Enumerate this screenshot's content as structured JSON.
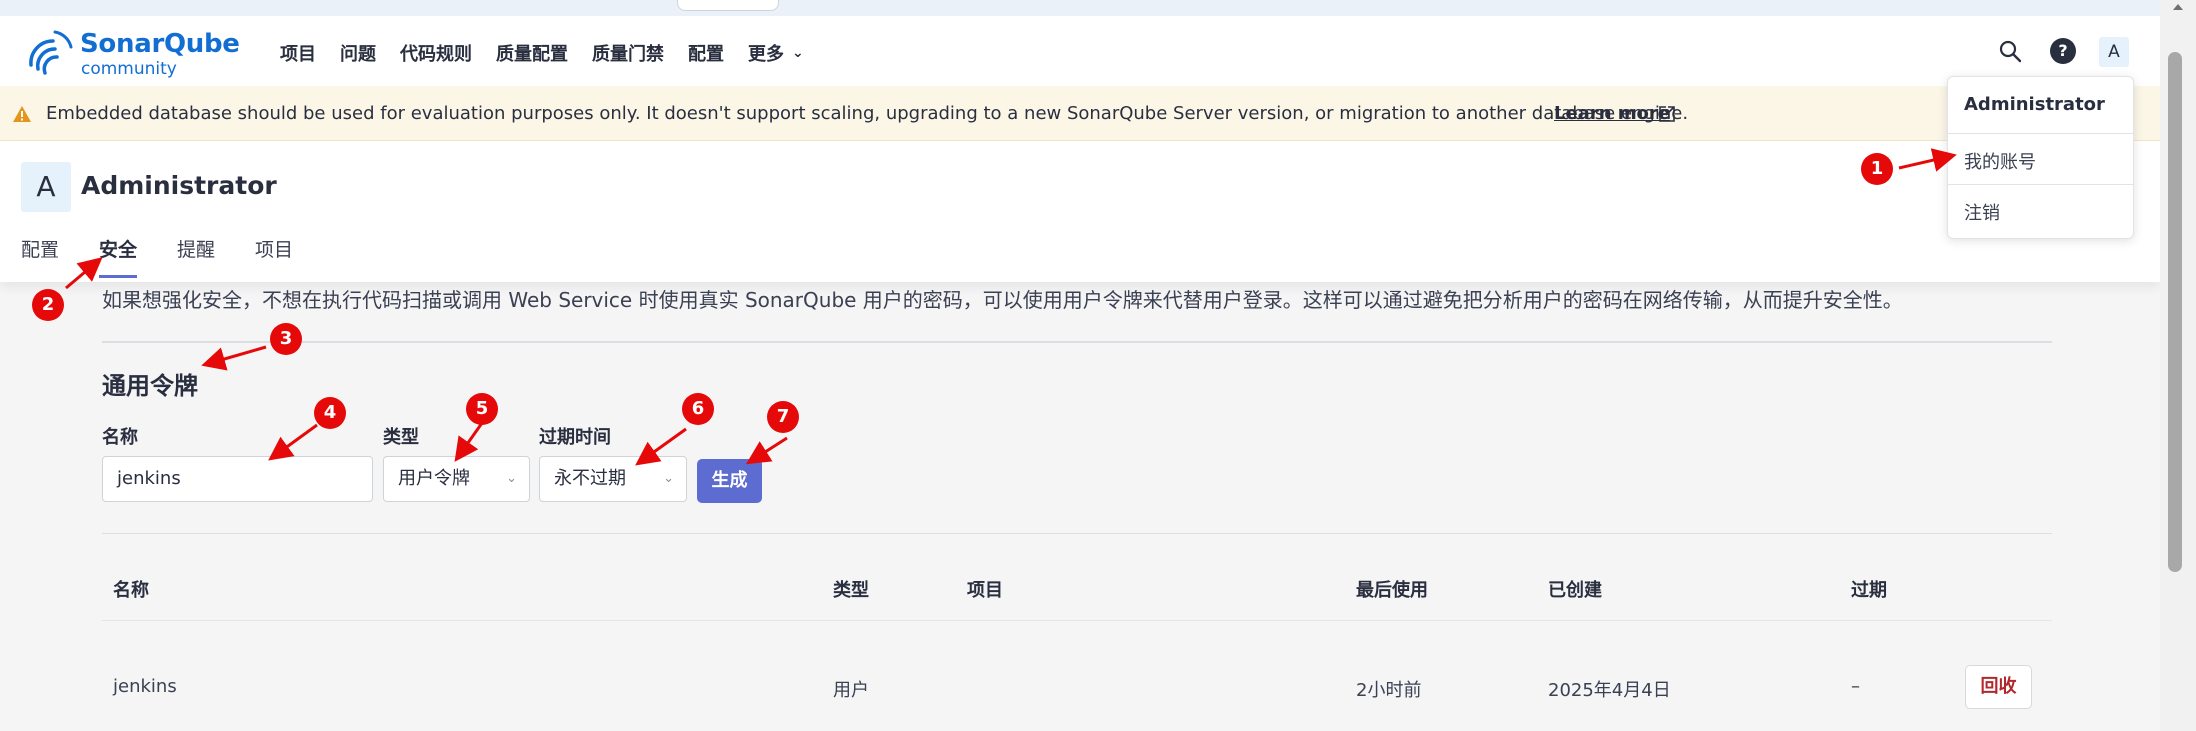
{
  "navbar": {
    "logo_name": "SonarQube",
    "logo_sub": "community",
    "items": [
      "项目",
      "问题",
      "代码规则",
      "质量配置",
      "质量门禁",
      "配置"
    ],
    "more_label": "更多",
    "help_label": "?",
    "avatar_letter": "A"
  },
  "warning": {
    "text": "Embedded database should be used for evaluation purposes only. It doesn't support scaling, upgrading to a new SonarQube Server version, or migration to another database engine.",
    "link": "Learn more"
  },
  "account": {
    "avatar_letter": "A",
    "name": "Administrator",
    "tabs": [
      {
        "label": "配置",
        "active": false
      },
      {
        "label": "安全",
        "active": true
      },
      {
        "label": "提醒",
        "active": false
      },
      {
        "label": "项目",
        "active": false
      }
    ]
  },
  "security": {
    "intro": "如果想强化安全，不想在执行代码扫描或调用 Web Service 时使用真实 SonarQube 用户的密码，可以使用用户令牌来代替用户登录。这样可以通过避免把分析用户的密码在网络传输，从而提升安全性。",
    "section_title": "通用令牌",
    "form": {
      "name_label": "名称",
      "name_value": "jenkins",
      "type_label": "类型",
      "type_value": "用户令牌",
      "expiry_label": "过期时间",
      "expiry_value": "永不过期",
      "generate_label": "生成"
    },
    "table": {
      "headers": [
        "名称",
        "类型",
        "项目",
        "最后使用",
        "已创建",
        "过期"
      ],
      "rows": [
        {
          "name": "jenkins",
          "type": "用户",
          "project": "",
          "last_used": "2小时前",
          "created": "2025年4月4日",
          "expiry": "–",
          "action": "回收"
        }
      ]
    }
  },
  "dropdown": {
    "title": "Administrator",
    "items": [
      "我的账号",
      "注销"
    ]
  },
  "annotations": [
    "1",
    "2",
    "3",
    "4",
    "5",
    "6",
    "7"
  ],
  "colors": {
    "accent": "#5d6cd0",
    "brand": "#126ed3",
    "annotation": "#e50909",
    "warning_bg": "#fcf6e7",
    "revoke": "#b2272b"
  }
}
